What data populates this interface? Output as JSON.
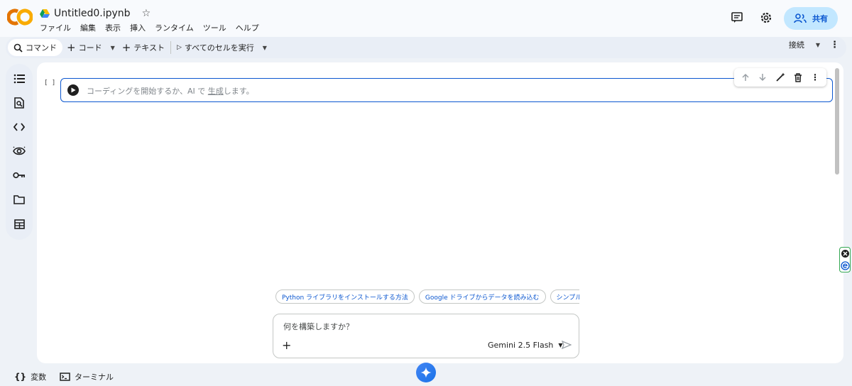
{
  "header": {
    "doc_title": "Untitled0.ipynb",
    "menu": [
      "ファイル",
      "編集",
      "表示",
      "挿入",
      "ランタイム",
      "ツール",
      "ヘルプ"
    ],
    "share_label": "共有"
  },
  "toolbar": {
    "command_label": "コマンド",
    "code_label": "コード",
    "text_label": "テキスト",
    "run_all_label": "すべてのセルを実行",
    "connect_label": "接続"
  },
  "cell": {
    "exec_count": "[ ]",
    "placeholder_before": "コーディングを開始するか、AI で",
    "placeholder_link": "生成",
    "placeholder_after": "します。"
  },
  "ai": {
    "suggestions": [
      "Python ライブラリをインストールする方法",
      "Google ドライブからデータを読み込む",
      "シンプルな M"
    ],
    "prompt": "何を構築しますか？",
    "model": "Gemini 2.5 Flash"
  },
  "bottom": {
    "variables_label": "変数",
    "terminal_label": "ターミナル"
  },
  "colors": {
    "accent": "#0b57d0",
    "share_bg": "#c2e7ff",
    "logo_orange": "#f9ab00",
    "logo_dark": "#e37400"
  }
}
